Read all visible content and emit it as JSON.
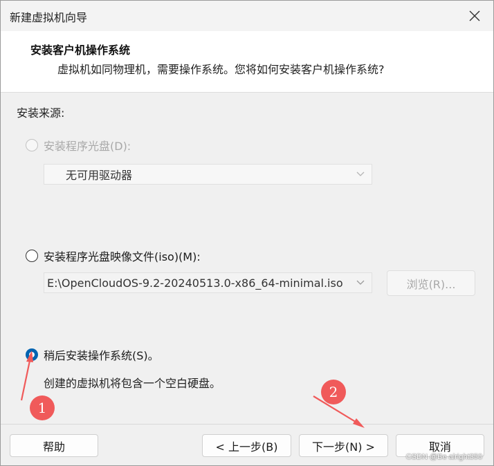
{
  "window": {
    "title": "新建虚拟机向导"
  },
  "header": {
    "title": "安装客户机操作系统",
    "subtitle": "虚拟机如同物理机，需要操作系统。您将如何安装客户机操作系统?"
  },
  "install_source": {
    "label": "安装来源:",
    "options": [
      {
        "label": "安装程序光盘(D):",
        "selected": false,
        "enabled": false,
        "dropdown_value": "无可用驱动器"
      },
      {
        "label": "安装程序光盘映像文件(iso)(M):",
        "selected": false,
        "enabled": true,
        "dropdown_value": "E:\\OpenCloudOS-9.2-20240513.0-x86_64-minimal.iso",
        "browse_label": "浏览(R)..."
      },
      {
        "label": "稍后安装操作系统(S)。",
        "selected": true,
        "enabled": true,
        "description": "创建的虚拟机将包含一个空白硬盘。"
      }
    ]
  },
  "footer": {
    "help_label": "帮助",
    "back_label": "< 上一步(B)",
    "next_label": "下一步(N) >",
    "cancel_label": "取消"
  },
  "annotations": {
    "badge_1": "1",
    "badge_2": "2",
    "color": "#f05a5a"
  },
  "watermark": "CSDN @Be alright350",
  "colors": {
    "accent": "#0063b1",
    "header_bg": "#ffffff",
    "body_bg": "#f0f0f0"
  }
}
